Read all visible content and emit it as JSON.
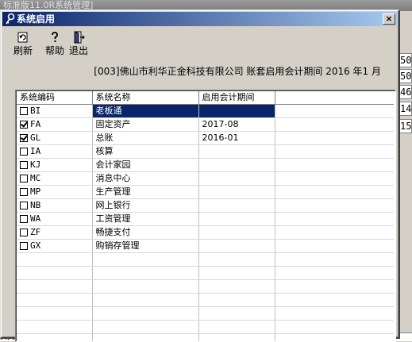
{
  "background": {
    "title": "标准版11.0R系统管理]",
    "right_values": [
      "50",
      "50",
      "46",
      "14",
      "15"
    ],
    "left_values": [
      "号",
      "3"
    ],
    "bottom_text": "负[ ]"
  },
  "dialog": {
    "title": "系统启用",
    "close_label": "×"
  },
  "toolbar": {
    "refresh_label": "刷新",
    "help_label": "帮助",
    "exit_label": "退出"
  },
  "info_text": "[003]佛山市利华正金科技有限公司 账套启用会计期间 2016 年1 月",
  "table": {
    "headers": [
      "系统编码",
      "系统名称",
      "启用会计期间"
    ],
    "rows": [
      {
        "checked": false,
        "code": "BI",
        "name": "老板通",
        "period": "",
        "selected": true
      },
      {
        "checked": true,
        "code": "FA",
        "name": "固定资产",
        "period": "2017-08",
        "selected": false
      },
      {
        "checked": true,
        "code": "GL",
        "name": "总账",
        "period": "2016-01",
        "selected": false
      },
      {
        "checked": false,
        "code": "IA",
        "name": "核算",
        "period": "",
        "selected": false
      },
      {
        "checked": false,
        "code": "KJ",
        "name": "会计家园",
        "period": "",
        "selected": false
      },
      {
        "checked": false,
        "code": "MC",
        "name": "消息中心",
        "period": "",
        "selected": false
      },
      {
        "checked": false,
        "code": "MP",
        "name": "生产管理",
        "period": "",
        "selected": false
      },
      {
        "checked": false,
        "code": "NB",
        "name": "网上银行",
        "period": "",
        "selected": false
      },
      {
        "checked": false,
        "code": "WA",
        "name": "工资管理",
        "period": "",
        "selected": false
      },
      {
        "checked": false,
        "code": "ZF",
        "name": "畅捷支付",
        "period": "",
        "selected": false
      },
      {
        "checked": false,
        "code": "GX",
        "name": "购销存管理",
        "period": "",
        "selected": false
      }
    ]
  }
}
